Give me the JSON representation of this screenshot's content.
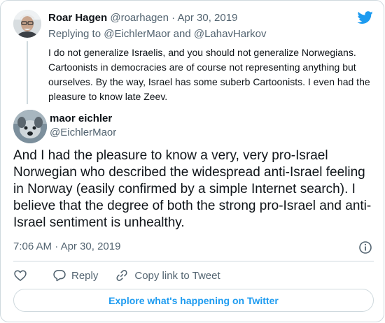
{
  "reply_tweet": {
    "name": "Roar Hagen",
    "handle": "@roarhagen",
    "separator": "·",
    "date": "Apr 30, 2019",
    "replying_prefix": "Replying to",
    "replying_to_1": "@EichlerMaor",
    "replying_and": "and",
    "replying_to_2": "@LahavHarkov",
    "text": "I do not generalize Israelis, and you should not generalize Norwegians. Cartoonists in democracies are of course not representing anything but ourselves. By the way, Israel has some suberb Cartoonists. I even had the pleasure to know late Zeev.",
    "avatar_icon": "profile-photo-man-glasses"
  },
  "main_tweet": {
    "name": "maor eichler",
    "handle": "@EichlerMaor",
    "avatar_icon": "profile-photo-dog",
    "text": "And I had the pleasure to know a very, very pro-Israel Norwegian who described the widespread anti-Israel feeling in Norway (easily confirmed by a simple Internet search). I believe that the degree of both the strong pro-Israel and anti-Israel sentiment is unhealthy.",
    "time": "7:06 AM",
    "separator": "·",
    "date": "Apr 30, 2019"
  },
  "actions": {
    "like_icon": "heart-icon",
    "reply_label": "Reply",
    "copy_link_label": "Copy link to Tweet"
  },
  "explore_label": "Explore what's happening on Twitter",
  "colors": {
    "brand": "#1d9bf0",
    "text": "#0f1419",
    "muted": "#536471",
    "border": "#cfd9de"
  }
}
